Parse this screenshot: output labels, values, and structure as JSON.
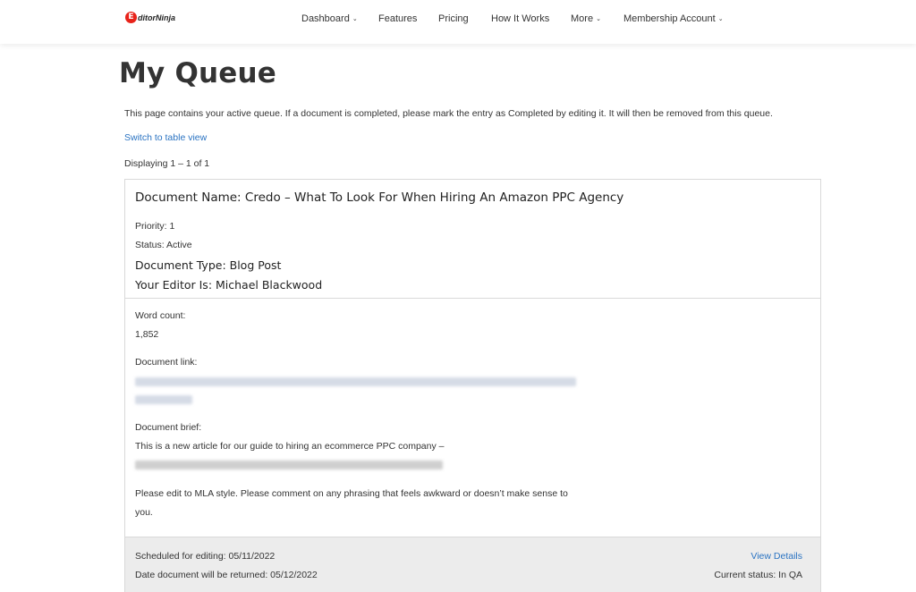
{
  "header": {
    "logo_mark": "E",
    "logo_text": "ditorNinja",
    "nav": [
      {
        "label": "Dashboard",
        "has_dropdown": true
      },
      {
        "label": "Features",
        "has_dropdown": false
      },
      {
        "label": "Pricing",
        "has_dropdown": false
      },
      {
        "label": "How It Works",
        "has_dropdown": false
      },
      {
        "label": "More",
        "has_dropdown": true
      },
      {
        "label": "Membership Account",
        "has_dropdown": true
      }
    ],
    "chevron": "⌄"
  },
  "page": {
    "title": "My Queue",
    "intro": "This page contains your active queue. If a document is completed, please mark the entry as Completed by editing it. It will then be removed from this queue.",
    "switch_link": "Switch to table view",
    "displaying": "Displaying 1 – 1 of 1"
  },
  "entry": {
    "document_name": "Document Name:  Credo – What To Look For When Hiring An Amazon PPC Agency",
    "priority": "Priority: 1",
    "status": "Status: Active",
    "document_type": "Document Type:  Blog Post",
    "editor": "Your Editor Is:  Michael Blackwood",
    "word_count_label": "Word count:",
    "word_count": "1,852",
    "document_link_label": "Document link:",
    "document_brief_label": "Document brief:",
    "brief_line1": "This is a new article for our guide to hiring an ecommerce PPC company –",
    "brief_line2": "Please edit to MLA style. Please comment on any phrasing that feels awkward or doesn’t make sense to",
    "brief_line3": "you.",
    "scheduled": "Scheduled for editing:  05/11/2022",
    "returned": "Date document will be returned:  05/12/2022",
    "view_details": "View Details",
    "current_status": "Current status:  In QA"
  },
  "colors": {
    "link": "#2a73c2",
    "logo": "#e8231a",
    "footer_bg": "#ececec"
  }
}
